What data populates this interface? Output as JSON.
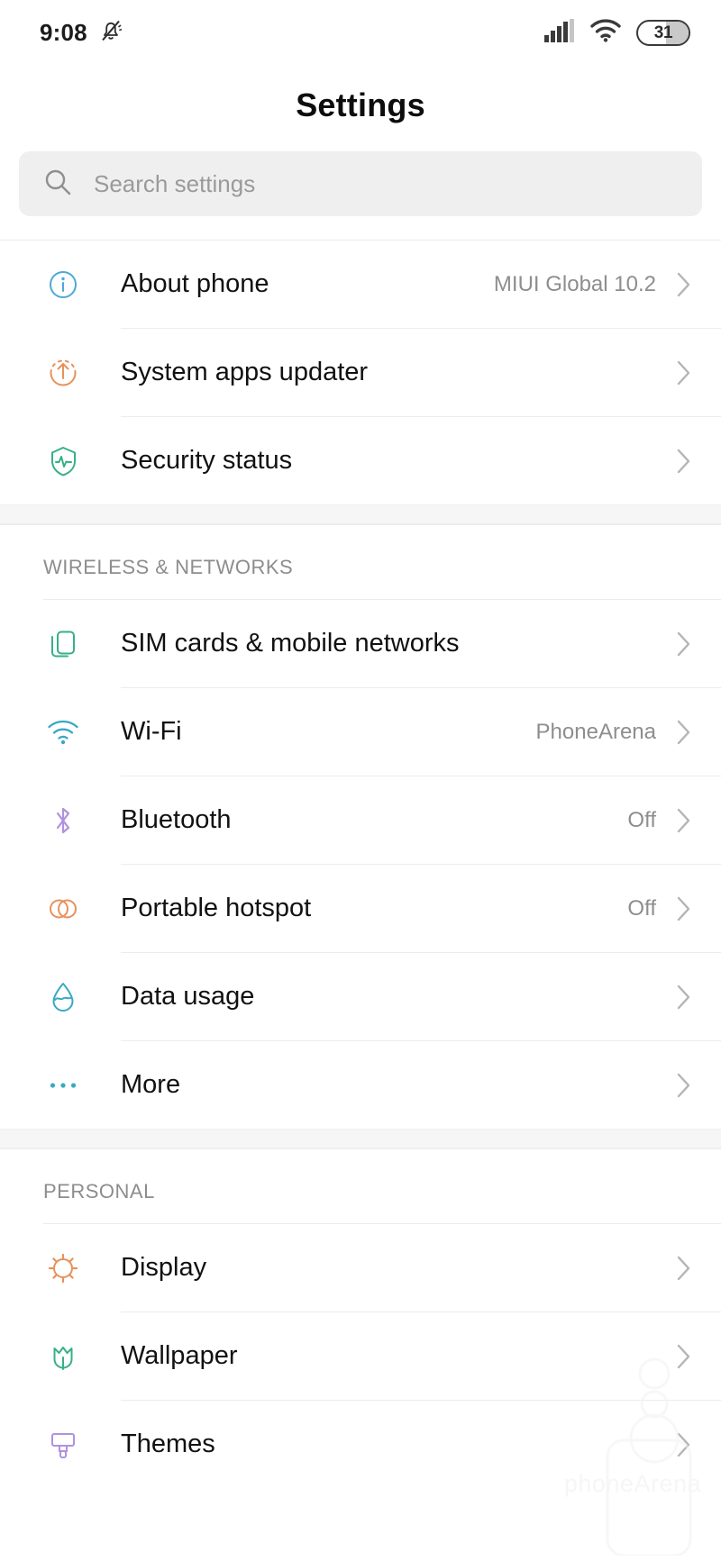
{
  "status_bar": {
    "time": "9:08",
    "mute_icon": "bell-off-icon",
    "signal_icon": "signal-bars-icon",
    "wifi_icon": "wifi-icon",
    "battery_level": "31"
  },
  "header": {
    "title": "Settings"
  },
  "search": {
    "icon": "search-icon",
    "placeholder": "Search settings",
    "value": ""
  },
  "groups": [
    {
      "section_label": "",
      "items": [
        {
          "icon": "info-circle-icon",
          "label": "About phone",
          "value": "MIUI Global 10.2"
        },
        {
          "icon": "system-update-icon",
          "label": "System apps updater",
          "value": ""
        },
        {
          "icon": "shield-pulse-icon",
          "label": "Security status",
          "value": ""
        }
      ]
    },
    {
      "section_label": "WIRELESS & NETWORKS",
      "items": [
        {
          "icon": "sim-cards-icon",
          "label": "SIM cards & mobile networks",
          "value": ""
        },
        {
          "icon": "wifi-icon",
          "label": "Wi-Fi",
          "value": "PhoneArena"
        },
        {
          "icon": "bluetooth-icon",
          "label": "Bluetooth",
          "value": "Off"
        },
        {
          "icon": "hotspot-icon",
          "label": "Portable hotspot",
          "value": "Off"
        },
        {
          "icon": "data-usage-droplet-icon",
          "label": "Data usage",
          "value": ""
        },
        {
          "icon": "more-dots-icon",
          "label": "More",
          "value": ""
        }
      ]
    },
    {
      "section_label": "PERSONAL",
      "items": [
        {
          "icon": "brightness-sun-icon",
          "label": "Display",
          "value": ""
        },
        {
          "icon": "wallpaper-flower-icon",
          "label": "Wallpaper",
          "value": ""
        },
        {
          "icon": "themes-brush-icon",
          "label": "Themes",
          "value": ""
        }
      ]
    }
  ],
  "watermark": {
    "text": "phoneArena"
  }
}
